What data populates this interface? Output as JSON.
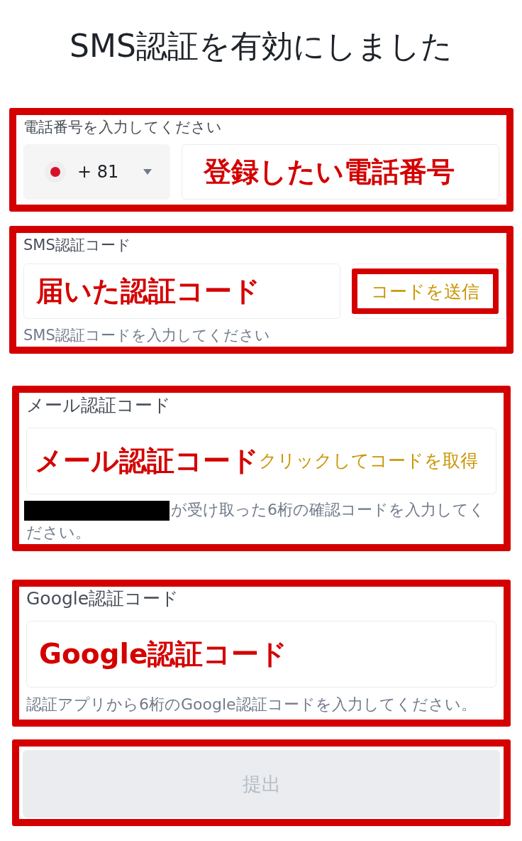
{
  "title": "SMS認証を有効にしました",
  "sections": [
    {
      "kind": "phone",
      "highlighted": true,
      "label": "電話番号を入力してください",
      "country_code": "+ 81",
      "annotation": "登録したい電話番号"
    },
    {
      "kind": "code_with_button",
      "highlighted": true,
      "label": "SMS認証コード",
      "annotation": "届いた認証コード",
      "action": {
        "label": "コードを送信",
        "highlighted": true
      },
      "hint": "SMS認証コードを入力してください"
    },
    {
      "kind": "code_with_link",
      "highlighted": true,
      "label": "メール認証コード",
      "annotation": "メール認証コード",
      "link": "クリックしてコードを取得",
      "redacted": true,
      "hint": "が受け取った6桁の確認コードを入力してください。"
    },
    {
      "kind": "code",
      "highlighted": true,
      "label": "Google認証コード",
      "annotation": "Google認証コード",
      "hint": "認証アプリから6桁のGoogle認証コードを入力してください。"
    }
  ],
  "submit": {
    "label": "提出",
    "disabled": true,
    "highlighted": true
  }
}
